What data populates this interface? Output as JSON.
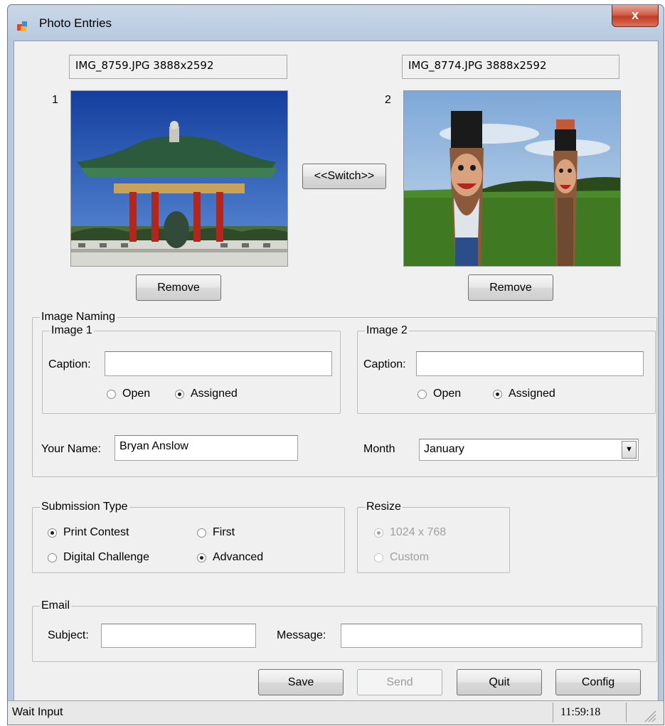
{
  "window": {
    "title": "Photo Entries",
    "close_label": "x"
  },
  "photos": {
    "left": {
      "index": "1",
      "file_info": "IMG_8759.JPG 3888x2592",
      "remove_label": "Remove"
    },
    "right": {
      "index": "2",
      "file_info": "IMG_8774.JPG 3888x2592",
      "remove_label": "Remove"
    },
    "switch_label": "<<Switch>>"
  },
  "image_naming": {
    "legend": "Image Naming",
    "image1": {
      "legend": "Image 1",
      "caption_label": "Caption:",
      "caption_value": "",
      "open_label": "Open",
      "assigned_label": "Assigned",
      "selected": "Assigned"
    },
    "image2": {
      "legend": "Image 2",
      "caption_label": "Caption:",
      "caption_value": "",
      "open_label": "Open",
      "assigned_label": "Assigned",
      "selected": "Assigned"
    },
    "your_name_label": "Your Name:",
    "your_name_value": "Bryan Anslow",
    "month_label": "Month",
    "month_value": "January"
  },
  "submission_type": {
    "legend": "Submission Type",
    "options": [
      "Print Contest",
      "First",
      "Digital Challenge",
      "Advanced"
    ],
    "selected": [
      "Print Contest",
      "Advanced"
    ]
  },
  "resize": {
    "legend": "Resize",
    "options": [
      "1024 x 768",
      "Custom"
    ],
    "selected": "1024 x 768",
    "enabled": false
  },
  "email": {
    "legend": "Email",
    "subject_label": "Subject:",
    "subject_value": "",
    "message_label": "Message:",
    "message_value": ""
  },
  "buttons": {
    "save": "Save",
    "send": "Send",
    "quit": "Quit",
    "config": "Config"
  },
  "status": {
    "text": "Wait Input",
    "time": "11:59:18"
  },
  "colors": {
    "sky_left": "#1c4fb8",
    "sky_right": "#8fb5df",
    "grass": "#3f7a22",
    "roof": "#2c5a3c",
    "pillar": "#b3261e"
  }
}
